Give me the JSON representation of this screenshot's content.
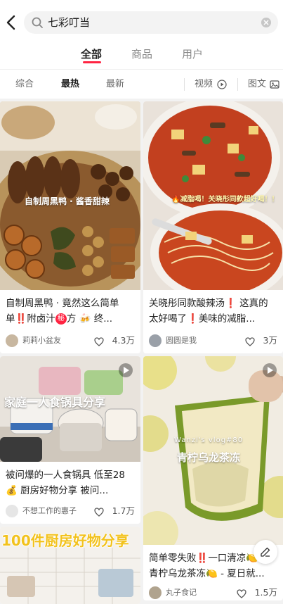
{
  "search": {
    "query": "七彩叮当"
  },
  "tabs": {
    "all": "全部",
    "goods": "商品",
    "users": "用户"
  },
  "filters": {
    "overall": "综合",
    "hottest": "最热",
    "newest": "最新",
    "video": "视频",
    "graphic": "图文"
  },
  "cards": [
    {
      "overlay": "自制周黑鸭 · 酱香甜辣",
      "title_a": "自制周黑鸭 · 竟然这么简单",
      "title_b": "附卤汁",
      "title_badge": "秘",
      "title_c": "方 🍻 终...",
      "author": "莉莉小盆友",
      "likes": "4.3万"
    },
    {
      "overlay": "🔥减脂喝！关晓彤同款超好喝！！",
      "title_a": "关晓彤同款酸辣汤",
      "title_b": "这真的太好喝了",
      "title_c": "美味的减脂...",
      "author": "圆圆是我",
      "likes": "3万"
    },
    {
      "overlay": "家庭一人食锅具分享",
      "title_a": "被问爆的一人食锅具 低至28",
      "title_b": "💰 厨房好物分享 被问...",
      "author": "不想工作的惠子",
      "likes": "1.7万"
    },
    {
      "overlay_small": "Wanzi's vlog#80",
      "overlay": "青柠乌龙茶冻",
      "title_a": "简单零失败",
      "title_b": "一口清凉🍋",
      "title_c": "青柠乌龙茶冻🍋 - 夏日就...",
      "author": "丸子食记",
      "likes": "1.5万"
    },
    {
      "overlay": "100件厨房好物分享"
    }
  ],
  "colors": {
    "accent": "#ff2442"
  },
  "icons": [
    "back-arrow-icon",
    "search-icon",
    "clear-icon",
    "play-icon",
    "image-icon",
    "heart-icon",
    "edit-icon"
  ]
}
